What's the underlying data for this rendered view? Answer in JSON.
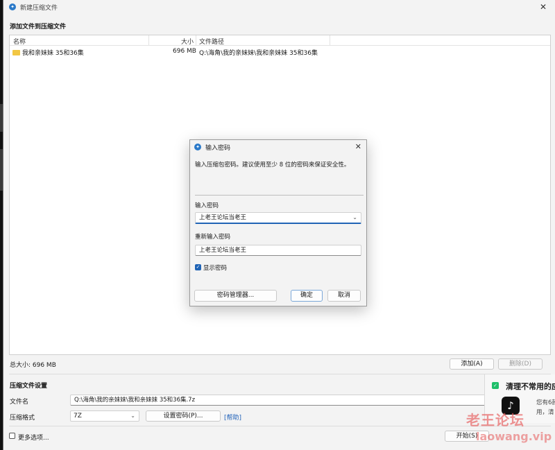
{
  "window": {
    "title": "新建压缩文件"
  },
  "add_section": {
    "label": "添加文件到压缩文件"
  },
  "file_list": {
    "columns": [
      "名称",
      "大小",
      "文件路径"
    ],
    "rows": [
      {
        "name": "我和亲妹妹 35和36集",
        "size": "696 MB",
        "path": "Q:\\海角\\我的亲妹妹\\我和亲妹妹 35和36集"
      }
    ]
  },
  "total_size": "总大小: 696 MB",
  "buttons": {
    "add": "添加(A)",
    "delete": "删除(D)",
    "start": "开始(S)"
  },
  "settings": {
    "label": "压缩文件设置",
    "filename_label": "文件名",
    "filename_value": "Q:\\海角\\我的亲妹妹\\我和亲妹妹 35和36集.7z",
    "format_label": "压缩格式",
    "format_value": "7Z",
    "set_password_button": "设置密码(P)...",
    "help_link": "[帮助]",
    "more_options": "更多选项..."
  },
  "dialog": {
    "title": "输入密码",
    "hint": "输入压缩包密码。建议使用至少 8 位的密码来保证安全性。",
    "password_label": "输入密码",
    "password_value": "上老王论坛当老王",
    "confirm_label": "重新输入密码",
    "confirm_value": "上老王论坛当老王",
    "show_password": "显示密码",
    "manager_button": "密码管理器...",
    "ok_button": "确定",
    "cancel_button": "取消"
  },
  "notification": {
    "title": "清理不常用的应",
    "line1": "您有6款",
    "line2": "用，清"
  },
  "watermark": {
    "text": "老王论坛",
    "url": "laowang.vip"
  },
  "colors": {
    "accent": "#1f63b5",
    "folder": "#f2c744",
    "watermark": "#e65a5a"
  }
}
